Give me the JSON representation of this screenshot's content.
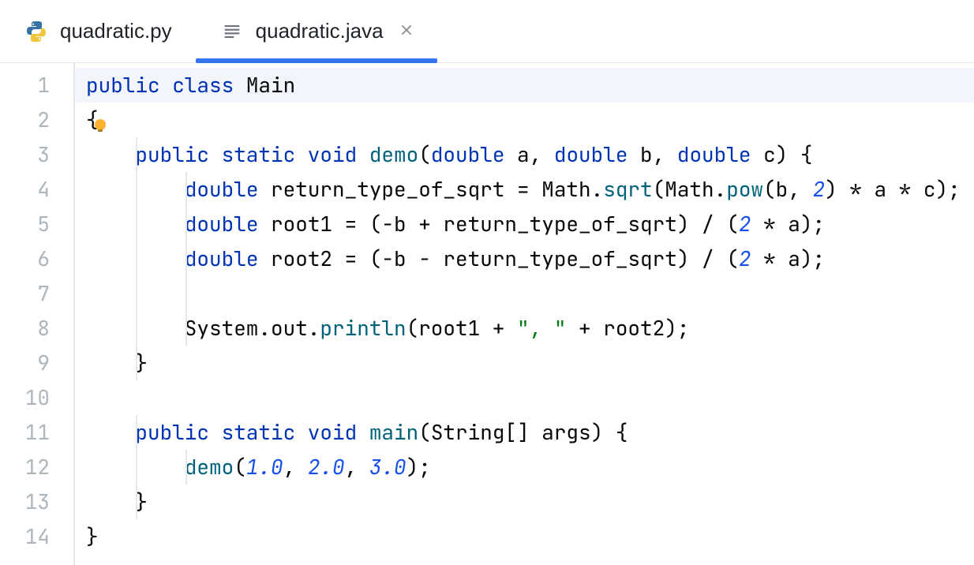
{
  "tabs": [
    {
      "label": "quadratic.py",
      "icon": "python-icon",
      "active": false
    },
    {
      "label": "quadratic.java",
      "icon": "file-icon",
      "active": true
    }
  ],
  "gutter": {
    "start": 1,
    "end": 14,
    "current": 1
  },
  "code": {
    "guide_cols": [
      4,
      8
    ],
    "lines": [
      {
        "n": 1,
        "current": true,
        "tokens": [
          {
            "t": "kw",
            "s": "public class "
          },
          {
            "t": "plain",
            "s": "Main"
          }
        ]
      },
      {
        "n": 2,
        "bulb": true,
        "tokens": [
          {
            "t": "plain",
            "s": "{"
          }
        ]
      },
      {
        "n": 3,
        "tokens": [
          {
            "t": "plain",
            "s": "    "
          },
          {
            "t": "kw",
            "s": "public static void "
          },
          {
            "t": "def",
            "s": "demo"
          },
          {
            "t": "plain",
            "s": "("
          },
          {
            "t": "kw",
            "s": "double "
          },
          {
            "t": "plain",
            "s": "a, "
          },
          {
            "t": "kw",
            "s": "double "
          },
          {
            "t": "plain",
            "s": "b, "
          },
          {
            "t": "kw",
            "s": "double "
          },
          {
            "t": "plain",
            "s": "c) {"
          }
        ]
      },
      {
        "n": 4,
        "tokens": [
          {
            "t": "plain",
            "s": "        "
          },
          {
            "t": "kw",
            "s": "double "
          },
          {
            "t": "plain",
            "s": "return_type_of_sqrt = Math."
          },
          {
            "t": "call",
            "s": "sqrt"
          },
          {
            "t": "plain",
            "s": "(Math."
          },
          {
            "t": "call",
            "s": "pow"
          },
          {
            "t": "plain",
            "s": "(b, "
          },
          {
            "t": "num",
            "s": "2"
          },
          {
            "t": "plain",
            "s": ") * a * c);"
          }
        ]
      },
      {
        "n": 5,
        "tokens": [
          {
            "t": "plain",
            "s": "        "
          },
          {
            "t": "kw",
            "s": "double "
          },
          {
            "t": "plain",
            "s": "root1 = (-b + return_type_of_sqrt) / ("
          },
          {
            "t": "num",
            "s": "2"
          },
          {
            "t": "plain",
            "s": " * a);"
          }
        ]
      },
      {
        "n": 6,
        "tokens": [
          {
            "t": "plain",
            "s": "        "
          },
          {
            "t": "kw",
            "s": "double "
          },
          {
            "t": "plain",
            "s": "root2 = (-b - return_type_of_sqrt) / ("
          },
          {
            "t": "num",
            "s": "2"
          },
          {
            "t": "plain",
            "s": " * a);"
          }
        ]
      },
      {
        "n": 7,
        "tokens": []
      },
      {
        "n": 8,
        "tokens": [
          {
            "t": "plain",
            "s": "        System.out."
          },
          {
            "t": "call",
            "s": "println"
          },
          {
            "t": "plain",
            "s": "(root1 + "
          },
          {
            "t": "str",
            "s": "\", \""
          },
          {
            "t": "plain",
            "s": " + root2);"
          }
        ]
      },
      {
        "n": 9,
        "tokens": [
          {
            "t": "plain",
            "s": "    }"
          }
        ]
      },
      {
        "n": 10,
        "tokens": []
      },
      {
        "n": 11,
        "tokens": [
          {
            "t": "plain",
            "s": "    "
          },
          {
            "t": "kw",
            "s": "public static void "
          },
          {
            "t": "def",
            "s": "main"
          },
          {
            "t": "plain",
            "s": "(String[] args) {"
          }
        ]
      },
      {
        "n": 12,
        "tokens": [
          {
            "t": "plain",
            "s": "        "
          },
          {
            "t": "call",
            "s": "demo"
          },
          {
            "t": "plain",
            "s": "("
          },
          {
            "t": "num",
            "s": "1.0"
          },
          {
            "t": "plain",
            "s": ", "
          },
          {
            "t": "num",
            "s": "2.0"
          },
          {
            "t": "plain",
            "s": ", "
          },
          {
            "t": "num",
            "s": "3.0"
          },
          {
            "t": "plain",
            "s": ");"
          }
        ]
      },
      {
        "n": 13,
        "tokens": [
          {
            "t": "plain",
            "s": "    }"
          }
        ]
      },
      {
        "n": 14,
        "tokens": [
          {
            "t": "plain",
            "s": "}"
          }
        ]
      }
    ]
  }
}
